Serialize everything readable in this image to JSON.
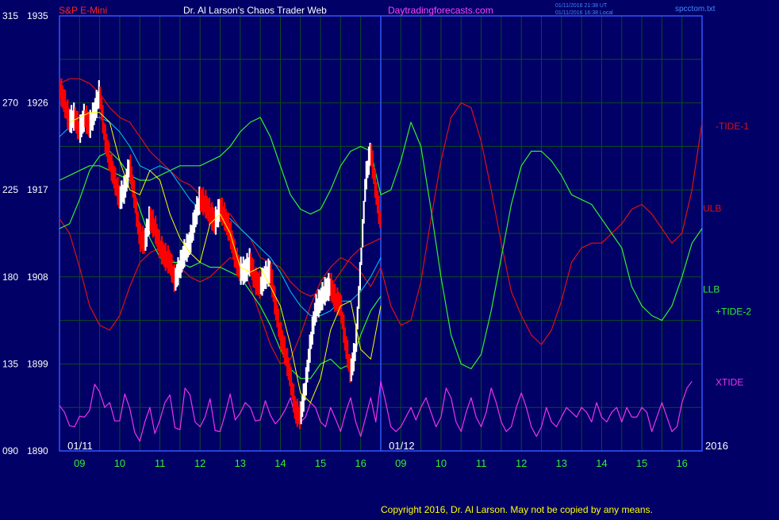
{
  "header": {
    "instrument": "S&P E-Mini",
    "site_title": "Dr. Al Larson's Chaos Trader Web",
    "url": "Daytradingforecasts.com",
    "timestamp_utc": "01/11/2016 21:38 UT",
    "timestamp_local": "01/11/2016 16:38 Local",
    "file": "spcctom.txt"
  },
  "footer": {
    "copyright": "Copyright 2016, Dr. Al Larson. May not be copied by any means."
  },
  "colors": {
    "background": "#000066",
    "plot_border": "#3355ff",
    "grid": "#0b4d1a",
    "price_up": "#ffffff",
    "price_down": "#ff0000",
    "ulb": "#dd1111",
    "llb": "#33ee33",
    "tide_minus1": "#dd1111",
    "tide_plus2": "#33ee33",
    "xtide": "#ee33ee",
    "ma_fast": "#ffff00",
    "ma_slow": "#00ccff",
    "left_axis_text": "#ffffff",
    "x_tick_text": "#33ee33",
    "date_label_text": "#ffffff"
  },
  "chart_data": {
    "type": "line",
    "title": "S&P E-Mini",
    "left_axis": {
      "tide_scale": [
        315,
        270,
        225,
        180,
        135,
        "090"
      ],
      "price_scale": [
        1935,
        1926,
        1917,
        1908,
        1899,
        1890
      ],
      "price_range": [
        1890,
        1935
      ]
    },
    "x_ticks": [
      "09",
      "10",
      "11",
      "12",
      "13",
      "14",
      "15",
      "16",
      "09",
      "10",
      "11",
      "12",
      "13",
      "14",
      "15",
      "16"
    ],
    "x_range": [
      8.0,
      40.0
    ],
    "date_labels": [
      {
        "text": "01/11",
        "x": 8.4
      },
      {
        "text": "01/12",
        "x": 24.4
      },
      {
        "text": "2016",
        "x": 40.0
      }
    ],
    "now_x": 24.0,
    "series_labels": [
      {
        "text": "-TIDE-1",
        "color_key": "tide_minus1",
        "y": 1923.6
      },
      {
        "text": "ULB",
        "color_key": "ulb",
        "y": 1915.1
      },
      {
        "text": "LLB",
        "color_key": "llb",
        "y": 1906.7
      },
      {
        "text": "+TIDE-2",
        "color_key": "tide_plus2",
        "y": 1904.4
      },
      {
        "text": "XTIDE",
        "color_key": "xtide",
        "y": 1897.1
      }
    ],
    "ulb": {
      "x": [
        8.0,
        8.5,
        9.0,
        9.5,
        10.0,
        10.5,
        11.0,
        11.5,
        12.0,
        12.5,
        13.0,
        13.5,
        14.0,
        14.5,
        15.0,
        15.5,
        16.0,
        16.5,
        17.0,
        17.5,
        18.0,
        18.5,
        19.0,
        19.5,
        20.0,
        20.5,
        21.0,
        21.5,
        22.0,
        22.5,
        23.0,
        23.5,
        24.0
      ],
      "y": [
        1928.0,
        1928.5,
        1928.5,
        1928.0,
        1927.0,
        1925.5,
        1924.5,
        1924.0,
        1922.5,
        1921.0,
        1920.0,
        1919.0,
        1918.0,
        1917.5,
        1916.5,
        1915.5,
        1914.5,
        1914.5,
        1913.0,
        1912.0,
        1910.0,
        1909.5,
        1909.0,
        1907.5,
        1906.5,
        1906.0,
        1906.5,
        1907.0,
        1908.5,
        1910.0,
        1911.0,
        1911.5,
        1912.0
      ]
    },
    "llb": {
      "x": [
        8.0,
        8.5,
        9.0,
        9.5,
        10.0,
        10.5,
        11.0,
        11.5,
        12.0,
        12.5,
        13.0,
        13.5,
        14.0,
        14.5,
        15.0,
        15.5,
        16.0,
        16.5,
        17.0,
        17.5,
        18.0,
        18.5,
        19.0,
        19.5,
        20.0,
        20.5,
        21.0,
        21.5,
        22.0,
        22.5,
        23.0,
        23.5,
        24.0
      ],
      "y": [
        1918.0,
        1918.5,
        1919.0,
        1919.5,
        1919.5,
        1919.0,
        1918.5,
        1918.0,
        1915.0,
        1912.0,
        1910.0,
        1909.5,
        1909.5,
        1909.0,
        1909.5,
        1909.0,
        1909.0,
        1908.5,
        1908.0,
        1906.5,
        1905.0,
        1903.0,
        1900.5,
        1898.5,
        1897.5,
        1897.5,
        1899.0,
        1899.5,
        1898.5,
        1899.0,
        1902.0,
        1904.5,
        1906.0
      ]
    },
    "tide_plus2": {
      "x": [
        8.0,
        8.5,
        9.0,
        9.5,
        10.0,
        10.5,
        11.0,
        11.5,
        12.0,
        12.5,
        13.0,
        13.5,
        14.0,
        14.5,
        15.0,
        15.5,
        16.0,
        16.5,
        17.0,
        17.5,
        18.0,
        18.5,
        19.0,
        19.5,
        20.0,
        20.5,
        21.0,
        21.5,
        22.0,
        22.5,
        23.0,
        23.5,
        24.0,
        24.5,
        25.0,
        25.5,
        26.0,
        26.5,
        27.0,
        27.5,
        28.0,
        28.5,
        29.0,
        29.5,
        30.0,
        30.5,
        31.0,
        31.5,
        32.0,
        32.5,
        33.0,
        33.5,
        34.0,
        34.5,
        35.0,
        35.5,
        36.0,
        36.5,
        37.0,
        37.5,
        38.0,
        38.5,
        39.0,
        39.5,
        40.0
      ],
      "y": [
        1913.0,
        1913.5,
        1916.0,
        1919.0,
        1920.5,
        1921.0,
        1920.0,
        1918.5,
        1918.0,
        1918.0,
        1918.5,
        1919.0,
        1919.5,
        1919.5,
        1919.5,
        1920.0,
        1920.5,
        1921.5,
        1923.0,
        1924.0,
        1924.5,
        1922.5,
        1919.5,
        1916.5,
        1915.0,
        1914.5,
        1915.0,
        1917.0,
        1919.5,
        1921.0,
        1921.5,
        1921.0,
        1916.5,
        1917.0,
        1920.0,
        1924.0,
        1921.5,
        1915.0,
        1908.0,
        1902.0,
        1899.0,
        1898.5,
        1900.0,
        1904.5,
        1910.0,
        1915.5,
        1919.5,
        1921.0,
        1921.0,
        1920.0,
        1918.5,
        1916.5,
        1916.0,
        1915.5,
        1914.0,
        1912.5,
        1911.0,
        1907.0,
        1905.0,
        1904.0,
        1903.5,
        1905.0,
        1908.0,
        1911.5,
        1913.0
      ]
    },
    "tide_minus1": {
      "x": [
        8.0,
        8.5,
        9.0,
        9.5,
        10.0,
        10.5,
        11.0,
        11.5,
        12.0,
        12.5,
        13.0,
        13.5,
        14.0,
        14.5,
        15.0,
        15.5,
        16.0,
        16.5,
        17.0,
        17.5,
        18.0,
        18.5,
        19.0,
        19.5,
        20.0,
        20.5,
        21.0,
        21.5,
        22.0,
        22.5,
        23.0,
        23.5,
        24.0,
        24.5,
        25.0,
        25.5,
        26.0,
        26.5,
        27.0,
        27.5,
        28.0,
        28.5,
        29.0,
        29.5,
        30.0,
        30.5,
        31.0,
        31.5,
        32.0,
        32.5,
        33.0,
        33.5,
        34.0,
        34.5,
        35.0,
        35.5,
        36.0,
        36.5,
        37.0,
        37.5,
        38.0,
        38.5,
        39.0,
        39.5,
        40.0
      ],
      "y": [
        1914.0,
        1912.5,
        1909.0,
        1905.0,
        1903.0,
        1902.5,
        1904.0,
        1907.0,
        1909.5,
        1910.5,
        1911.0,
        1910.0,
        1909.0,
        1908.0,
        1907.5,
        1908.0,
        1909.0,
        1910.0,
        1909.5,
        1907.0,
        1904.0,
        1901.0,
        1899.0,
        1899.5,
        1902.0,
        1905.0,
        1907.5,
        1909.0,
        1910.0,
        1909.5,
        1908.5,
        1907.0,
        1909.0,
        1905.0,
        1903.0,
        1903.5,
        1907.5,
        1914.0,
        1920.0,
        1924.5,
        1926.0,
        1925.5,
        1922.0,
        1917.0,
        1911.5,
        1906.5,
        1904.0,
        1902.0,
        1901.0,
        1902.5,
        1905.5,
        1909.5,
        1911.0,
        1911.5,
        1911.5,
        1912.5,
        1913.5,
        1915.0,
        1915.5,
        1914.5,
        1913.0,
        1911.5,
        1912.5,
        1917.0,
        1924.0
      ]
    },
    "ma_fast": {
      "x": [
        8.5,
        9.0,
        9.5,
        10.0,
        10.5,
        11.0,
        11.5,
        12.0,
        12.5,
        13.0,
        13.5,
        14.0,
        14.5,
        15.0,
        15.5,
        16.0,
        16.5,
        17.0,
        17.5,
        18.0,
        18.5,
        19.0,
        19.5,
        20.0,
        20.5,
        21.0,
        21.5,
        22.0,
        22.5,
        23.0,
        23.5,
        24.0
      ],
      "y": [
        1924.0,
        1924.5,
        1925.0,
        1925.0,
        1924.0,
        1920.0,
        1917.0,
        1916.5,
        1919.0,
        1918.0,
        1914.5,
        1912.0,
        1910.5,
        1909.5,
        1913.5,
        1914.5,
        1912.5,
        1909.0,
        1908.5,
        1909.0,
        1907.0,
        1905.0,
        1901.0,
        1896.0,
        1895.0,
        1897.5,
        1902.5,
        1905.0,
        1905.5,
        1900.5,
        1899.5,
        1905.0
      ]
    },
    "ma_slow": {
      "x": [
        8.0,
        8.5,
        9.0,
        9.5,
        10.0,
        10.5,
        11.0,
        11.5,
        12.0,
        12.5,
        13.0,
        13.5,
        14.0,
        14.5,
        15.0,
        15.5,
        16.0,
        16.5,
        17.0,
        17.5,
        18.0,
        18.5,
        19.0,
        19.5,
        20.0,
        20.5,
        21.0,
        21.5,
        22.0,
        22.5,
        23.0,
        23.5,
        24.0
      ],
      "y": [
        1922.5,
        1923.5,
        1924.0,
        1924.5,
        1924.5,
        1924.0,
        1923.0,
        1921.5,
        1919.5,
        1919.0,
        1919.5,
        1919.0,
        1917.5,
        1916.0,
        1915.0,
        1914.5,
        1914.5,
        1914.0,
        1913.0,
        1912.0,
        1911.0,
        1910.0,
        1908.5,
        1906.5,
        1905.0,
        1904.0,
        1904.0,
        1904.5,
        1905.5,
        1905.5,
        1906.5,
        1908.0,
        1910.0
      ]
    },
    "xtide": {
      "x": [
        8.0,
        8.25,
        8.5,
        8.75,
        9.0,
        9.25,
        9.5,
        9.75,
        10.0,
        10.25,
        10.5,
        10.75,
        11.0,
        11.25,
        11.5,
        11.75,
        12.0,
        12.25,
        12.5,
        12.75,
        13.0,
        13.25,
        13.5,
        13.75,
        14.0,
        14.25,
        14.5,
        14.75,
        15.0,
        15.25,
        15.5,
        15.75,
        16.0,
        16.25,
        16.5,
        16.75,
        17.0,
        17.25,
        17.5,
        17.75,
        18.0,
        18.25,
        18.5,
        18.75,
        19.0,
        19.25,
        19.5,
        19.75,
        20.0,
        20.25,
        20.5,
        20.75,
        21.0,
        21.25,
        21.5,
        21.75,
        22.0,
        22.25,
        22.5,
        22.75,
        23.0,
        23.25,
        23.5,
        23.75,
        24.0,
        24.25,
        24.5,
        24.75,
        25.0,
        25.25,
        25.5,
        25.75,
        26.0,
        26.25,
        26.5,
        26.75,
        27.0,
        27.25,
        27.5,
        27.75,
        28.0,
        28.25,
        28.5,
        28.75,
        29.0,
        29.25,
        29.5,
        29.75,
        30.0,
        30.25,
        30.5,
        30.75,
        31.0,
        31.25,
        31.5,
        31.75,
        32.0,
        32.25,
        32.5,
        32.75,
        33.0,
        33.25,
        33.5,
        33.75,
        34.0,
        34.25,
        34.5,
        34.75,
        35.0,
        35.25,
        35.5,
        35.75,
        36.0,
        36.25,
        36.5,
        36.75,
        37.0,
        37.25,
        37.5,
        37.75,
        38.0,
        38.25,
        38.5,
        38.75,
        39.0,
        39.25,
        39.5,
        39.75,
        40.0
      ],
      "y": [
        1894.7,
        1894.0,
        1892.6,
        1892.5,
        1893.6,
        1893.5,
        1894.2,
        1896.9,
        1896.1,
        1894.5,
        1895.0,
        1893.1,
        1893.1,
        1895.9,
        1894.4,
        1891.9,
        1891.0,
        1893.0,
        1894.5,
        1891.8,
        1893.2,
        1895.0,
        1895.8,
        1892.4,
        1892.2,
        1896.5,
        1895.8,
        1893.0,
        1892.5,
        1893.5,
        1895.4,
        1892.1,
        1892.0,
        1893.8,
        1895.9,
        1893.2,
        1893.9,
        1895.0,
        1894.5,
        1893.1,
        1893.2,
        1895.2,
        1893.7,
        1892.8,
        1893.4,
        1894.3,
        1895.5,
        1893.5,
        1893.0,
        1893.5,
        1895.0,
        1894.5,
        1893.0,
        1892.5,
        1894.5,
        1893.3,
        1892.0,
        1894.0,
        1895.5,
        1893.0,
        1891.5,
        1893.5,
        1895.5,
        1893.0,
        1897.2,
        1895.0,
        1892.5,
        1892.0,
        1892.5,
        1893.5,
        1894.5,
        1893.2,
        1894.5,
        1895.5,
        1894.0,
        1892.5,
        1893.5,
        1896.5,
        1895.5,
        1893.0,
        1892.0,
        1894.0,
        1895.5,
        1893.5,
        1892.5,
        1894.0,
        1896.5,
        1895.0,
        1893.0,
        1892.0,
        1892.5,
        1894.5,
        1896.0,
        1894.5,
        1892.5,
        1891.5,
        1892.5,
        1894.5,
        1893.0,
        1892.5,
        1893.5,
        1894.5,
        1894.0,
        1893.5,
        1894.5,
        1894.0,
        1893.0,
        1895.0,
        1893.5,
        1893.0,
        1894.0,
        1894.5,
        1893.0,
        1894.5,
        1893.5,
        1893.5,
        1894.5,
        1894.0,
        1892.0,
        1893.5,
        1895.0,
        1893.5,
        1892.0,
        1892.5,
        1895.0,
        1896.5,
        1897.2
      ]
    },
    "price": {
      "x": [
        8.0,
        8.25,
        8.5,
        8.75,
        9.0,
        9.25,
        9.5,
        9.75,
        10.0,
        10.25,
        10.5,
        10.75,
        11.0,
        11.25,
        11.5,
        11.75,
        12.0,
        12.25,
        12.5,
        12.75,
        13.0,
        13.25,
        13.5,
        13.75,
        14.0,
        14.25,
        14.5,
        14.75,
        15.0,
        15.25,
        15.5,
        15.75,
        16.0,
        16.25,
        16.5,
        16.75,
        17.0,
        17.25,
        17.5,
        17.75,
        18.0,
        18.25,
        18.5,
        18.75,
        19.0,
        19.25,
        19.5,
        19.75,
        20.0,
        20.25,
        20.5,
        20.75,
        21.0,
        21.25,
        21.5,
        21.75,
        22.0,
        22.25,
        22.5,
        22.75,
        23.0,
        23.25,
        23.5,
        23.75,
        24.0
      ],
      "y": [
        1927.5,
        1926.0,
        1924.0,
        1924.5,
        1923.0,
        1924.5,
        1923.5,
        1925.0,
        1927.0,
        1922.5,
        1920.0,
        1918.0,
        1916.0,
        1917.0,
        1919.5,
        1916.0,
        1912.0,
        1911.5,
        1914.0,
        1913.0,
        1911.0,
        1910.0,
        1909.5,
        1907.5,
        1909.0,
        1910.5,
        1911.5,
        1914.0,
        1916.0,
        1915.5,
        1914.5,
        1913.5,
        1915.0,
        1914.0,
        1912.5,
        1910.0,
        1908.5,
        1908.5,
        1909.5,
        1907.5,
        1907.0,
        1908.0,
        1908.5,
        1905.0,
        1902.0,
        1900.0,
        1897.5,
        1894.0,
        1893.5,
        1896.5,
        1901.0,
        1904.5,
        1905.5,
        1906.5,
        1907.0,
        1905.5,
        1905.0,
        1901.0,
        1898.0,
        1900.5,
        1909.0,
        1918.0,
        1921.0,
        1917.0,
        1913.5
      ]
    }
  }
}
